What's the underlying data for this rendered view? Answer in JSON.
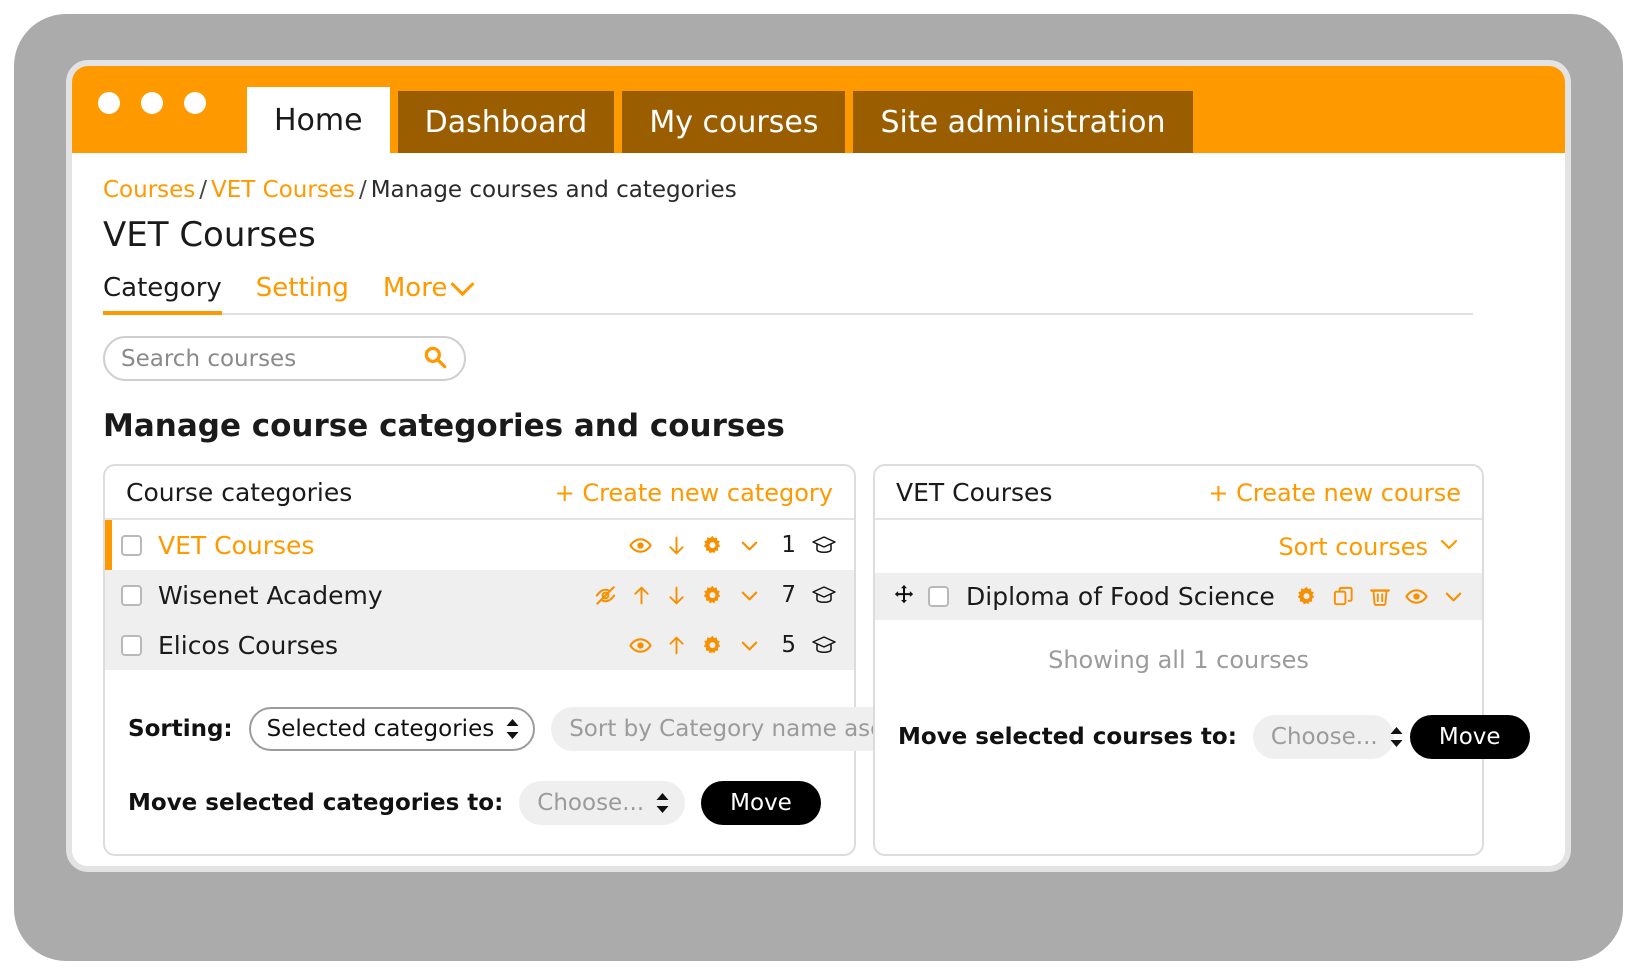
{
  "window": {
    "traffic_lights": [
      "close",
      "minimize",
      "maximize"
    ],
    "tabs": [
      {
        "label": "Home",
        "active": true
      },
      {
        "label": "Dashboard",
        "active": false
      },
      {
        "label": "My courses",
        "active": false
      },
      {
        "label": "Site administration",
        "active": false
      }
    ]
  },
  "breadcrumb": {
    "items": [
      {
        "label": "Courses",
        "link": true
      },
      {
        "label": "VET Courses",
        "link": true
      },
      {
        "label": "Manage courses and categories",
        "link": false
      }
    ],
    "separator": "/"
  },
  "page": {
    "title": "VET Courses",
    "section_heading": "Manage course categories and courses"
  },
  "secondary_nav": {
    "items": [
      {
        "label": "Category",
        "active": true,
        "chevron": false
      },
      {
        "label": "Setting",
        "active": false,
        "chevron": false
      },
      {
        "label": "More",
        "active": false,
        "chevron": true
      }
    ]
  },
  "search": {
    "value": "",
    "placeholder": "Search courses",
    "icon": "search-icon"
  },
  "categories_panel": {
    "title": "Course categories",
    "create_label": "+ Create new category",
    "rows": [
      {
        "name": "VET Courses",
        "checked": false,
        "current": true,
        "shaded": false,
        "highlight": true,
        "visible": true,
        "has_up": false,
        "has_down": true,
        "course_count": "1"
      },
      {
        "name": "Wisenet Academy",
        "checked": false,
        "current": false,
        "shaded": true,
        "highlight": false,
        "visible": false,
        "has_up": true,
        "has_down": true,
        "course_count": "7"
      },
      {
        "name": "Elicos Courses",
        "checked": false,
        "current": false,
        "shaded": true,
        "highlight": false,
        "visible": true,
        "has_up": true,
        "has_down": false,
        "course_count": "5"
      }
    ],
    "sorting": {
      "label": "Sorting:",
      "scope_value": "Selected categories",
      "order_value": "Sort by Category name ascending"
    },
    "move": {
      "label": "Move selected categories to:",
      "select_value": "Choose...",
      "button_label": "Move"
    }
  },
  "courses_panel": {
    "title": "VET Courses",
    "create_label": "+ Create new course",
    "sort_label": "Sort courses",
    "rows": [
      {
        "name": "Diploma of Food Science",
        "checked": false
      }
    ],
    "showing_text": "Showing all 1 courses",
    "move": {
      "label": "Move selected courses to:",
      "select_value": "Choose...",
      "button_label": "Move"
    }
  },
  "colors": {
    "accent_orange": "#ff9900",
    "tab_brown": "#9a5e00",
    "bezel_gray": "#ababab",
    "row_shade": "#efefef",
    "button_black": "#000000",
    "muted_text": "#9b9b9b"
  }
}
